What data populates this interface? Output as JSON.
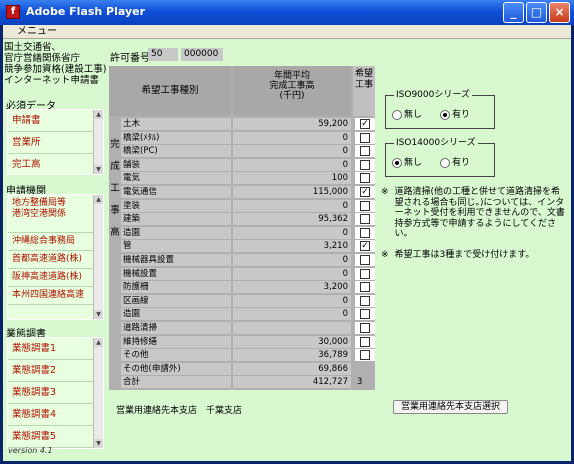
{
  "window": {
    "title": "Adobe Flash Player",
    "icon": "flash-icon"
  },
  "menu": {
    "label": "メニュー"
  },
  "agency": {
    "line1": "国土交通省、",
    "line2": "官庁営繕関係省庁",
    "line3": "競争参加資格(建設工事)",
    "line4": "インターネット申請書"
  },
  "permit": {
    "label": "許可番号",
    "value1": "50",
    "value2": "000000"
  },
  "sidebar": {
    "required_header": "必須データ",
    "required_items": [
      "申請書",
      "営業所",
      "完工高"
    ],
    "institutions_header": "申請機関",
    "institutions": [
      "地方整備局等\n港湾空港関係",
      "沖縄総合事務局",
      "首都高速道路(株)",
      "阪神高速道路(株)",
      "本州四国連絡高速"
    ],
    "survey_header": "業態調書",
    "survey_items": [
      "業態調書1",
      "業態調書2",
      "業態調書3",
      "業態調書4",
      "業態調書5"
    ]
  },
  "table": {
    "header_type": "希望工事種別",
    "header_avg_l1": "年間平均",
    "header_avg_l2": "完成工事高",
    "header_avg_l3": "(千円)",
    "header_wish_l1": "希望",
    "header_wish_l2": "工事",
    "vertical_label": [
      "完",
      "成",
      "工",
      "事",
      "高"
    ],
    "rows": [
      {
        "name": "土木",
        "value": "59,200",
        "checked": true
      },
      {
        "name": "橋梁(ﾒﾀﾙ)",
        "value": "0",
        "checked": false
      },
      {
        "name": "橋梁(PC)",
        "value": "0",
        "checked": false
      },
      {
        "name": "舗装",
        "value": "0",
        "checked": false
      },
      {
        "name": "電気",
        "value": "100",
        "checked": false
      },
      {
        "name": "電気通信",
        "value": "115,000",
        "checked": true
      },
      {
        "name": "塗装",
        "value": "0",
        "checked": false
      },
      {
        "name": "建築",
        "value": "95,362",
        "checked": false
      },
      {
        "name": "造園",
        "value": "0",
        "checked": false
      },
      {
        "name": "管",
        "value": "3,210",
        "checked": true
      },
      {
        "name": "機械器具設置",
        "value": "0",
        "checked": false
      },
      {
        "name": "機械設置",
        "value": "0",
        "checked": false
      },
      {
        "name": "防護柵",
        "value": "3,200",
        "checked": false
      },
      {
        "name": "区画線",
        "value": "0",
        "checked": false
      },
      {
        "name": "造園",
        "value": "0",
        "checked": false
      },
      {
        "name": "道路清掃",
        "value": "",
        "checked": false
      },
      {
        "name": "維持修繕",
        "value": "30,000",
        "checked": false
      },
      {
        "name": "その他",
        "value": "36,789",
        "checked": false
      },
      {
        "name": "その他(申請外)",
        "value": "69,866",
        "checked": null
      },
      {
        "name": "合計",
        "value": "412,727",
        "checked": null,
        "extra": "3"
      }
    ]
  },
  "iso9000": {
    "label": "ISO9000シリーズ",
    "none": "無し",
    "has": "有り",
    "selected": "has"
  },
  "iso14000": {
    "label": "ISO14000シリーズ",
    "none": "無し",
    "has": "有り",
    "selected": "none"
  },
  "notes": {
    "mark": "※",
    "note1": "道路清掃(他の工種と併せて道路清掃を希望される場合も同じ。)については、インターネット受付を利用できませんので、文書持参方式等で申請するようにしてください。",
    "note2": "希望工事は3種まで受け付けます。"
  },
  "branch": {
    "label": "営業用連絡先本支店　千葉支店",
    "button": "営業用連絡先本支店選択"
  },
  "version": "version 4.1"
}
